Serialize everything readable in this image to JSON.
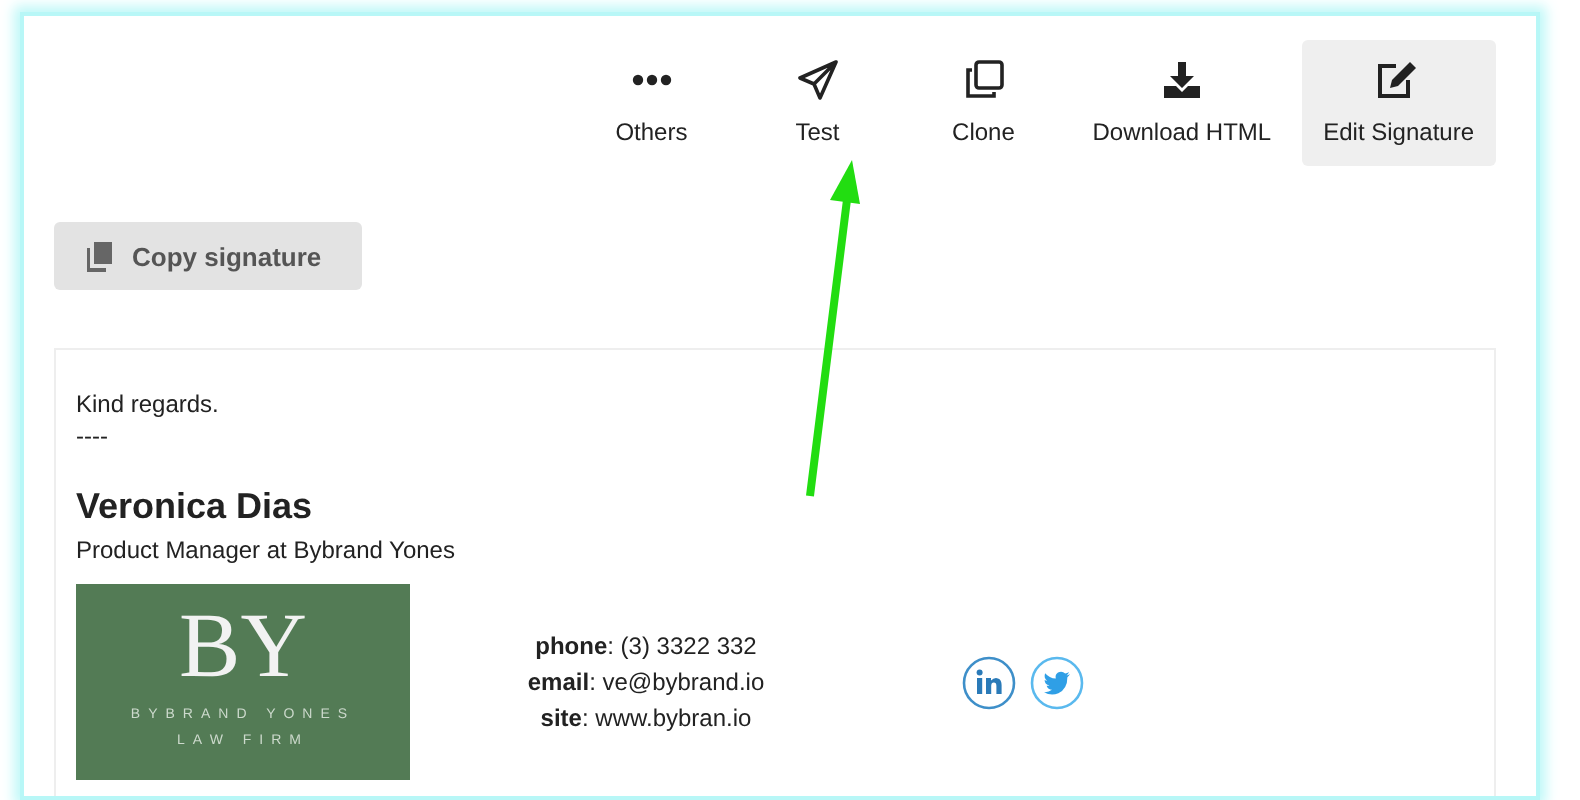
{
  "toolbar": [
    {
      "kind": "more",
      "label": "Others",
      "selected": false
    },
    {
      "kind": "send",
      "label": "Test",
      "selected": false
    },
    {
      "kind": "clone",
      "label": "Clone",
      "selected": false
    },
    {
      "kind": "download",
      "label": "Download HTML",
      "selected": false
    },
    {
      "kind": "edit",
      "label": "Edit Signature",
      "selected": true
    }
  ],
  "copy_button": {
    "label": "Copy signature"
  },
  "signature": {
    "greeting": "Kind regards.",
    "separator": "----",
    "name": "Veronica Dias",
    "title": "Product Manager at Bybrand Yones",
    "logo": {
      "monogram": "BY",
      "company": "BYBRAND YONES",
      "subtitle": "LAW FIRM"
    },
    "contacts": [
      {
        "label": "phone",
        "value": ": (3) 3322 332"
      },
      {
        "label": "email",
        "value": ": ve@bybrand.io"
      },
      {
        "label": "site",
        "value": ": www.bybran.io"
      }
    ],
    "social": [
      {
        "kind": "linkedin"
      },
      {
        "kind": "twitter"
      }
    ]
  }
}
